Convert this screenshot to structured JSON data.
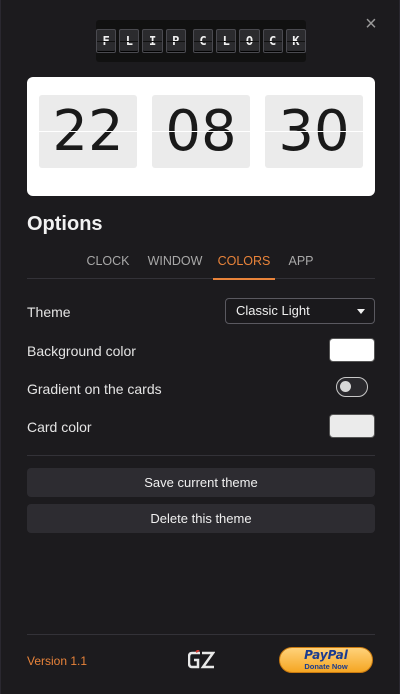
{
  "window": {
    "close_glyph": "×"
  },
  "logo": {
    "letters": [
      "F",
      "L",
      "I",
      "P",
      "C",
      "L",
      "O",
      "C",
      "K"
    ]
  },
  "clock": {
    "hours": "22",
    "minutes": "08",
    "seconds": "30"
  },
  "options": {
    "title": "Options",
    "tabs": [
      {
        "label": "CLOCK",
        "active": false
      },
      {
        "label": "WINDOW",
        "active": false
      },
      {
        "label": "COLORS",
        "active": true
      },
      {
        "label": "APP",
        "active": false
      }
    ]
  },
  "colors": {
    "theme_label": "Theme",
    "theme_value": "Classic Light",
    "background_label": "Background color",
    "background_color": "#ffffff",
    "gradient_label": "Gradient on the cards",
    "gradient_enabled": false,
    "card_label": "Card color",
    "card_color": "#ebebeb",
    "save_button": "Save current theme",
    "delete_button": "Delete this theme"
  },
  "footer": {
    "version": "Version 1.1",
    "brand_logo": "GZ",
    "paypal_name": "PayPal",
    "paypal_sub": "Donate Now"
  },
  "accent_color": "#e8833a"
}
